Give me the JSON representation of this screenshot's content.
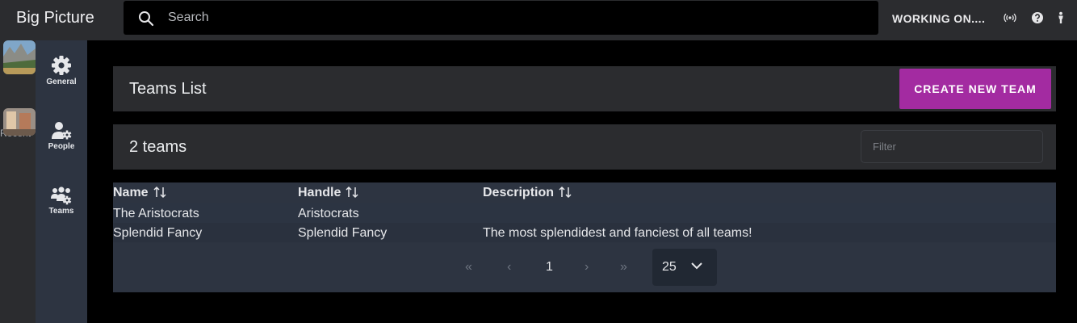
{
  "app": {
    "title": "Big Picture"
  },
  "search": {
    "placeholder": "Search"
  },
  "topbar": {
    "status": "WORKING ON....",
    "icons": [
      "broadcast-icon",
      "help-icon",
      "person-icon"
    ]
  },
  "recent": {
    "label": "Recent",
    "thumbnails": [
      "landscape-thumbnail",
      "landscape-thumbnail"
    ]
  },
  "nav": {
    "items": [
      {
        "label": "General",
        "icon": "gear-icon"
      },
      {
        "label": "People",
        "icon": "user-gear-icon"
      },
      {
        "label": "Teams",
        "icon": "users-gear-icon"
      }
    ]
  },
  "header": {
    "title": "Teams List",
    "create_button": "CREATE NEW TEAM"
  },
  "summary": {
    "count_text": "2 teams",
    "filter_placeholder": "Filter"
  },
  "table": {
    "columns": [
      "Name",
      "Handle",
      "Description"
    ],
    "rows": [
      {
        "name": "The Aristocrats",
        "handle": "Aristocrats",
        "description": ""
      },
      {
        "name": "Splendid Fancy",
        "handle": "Splendid Fancy",
        "description": "The most splendidest and fanciest of all teams!"
      }
    ]
  },
  "pagination": {
    "first": "«",
    "prev": "‹",
    "current_page": "1",
    "next": "›",
    "last": "»",
    "per_page": "25"
  },
  "colors": {
    "accent": "#a32ba1",
    "topbar": "#2b2c2f",
    "nav": "#2d3441",
    "table": "#2d3441"
  }
}
